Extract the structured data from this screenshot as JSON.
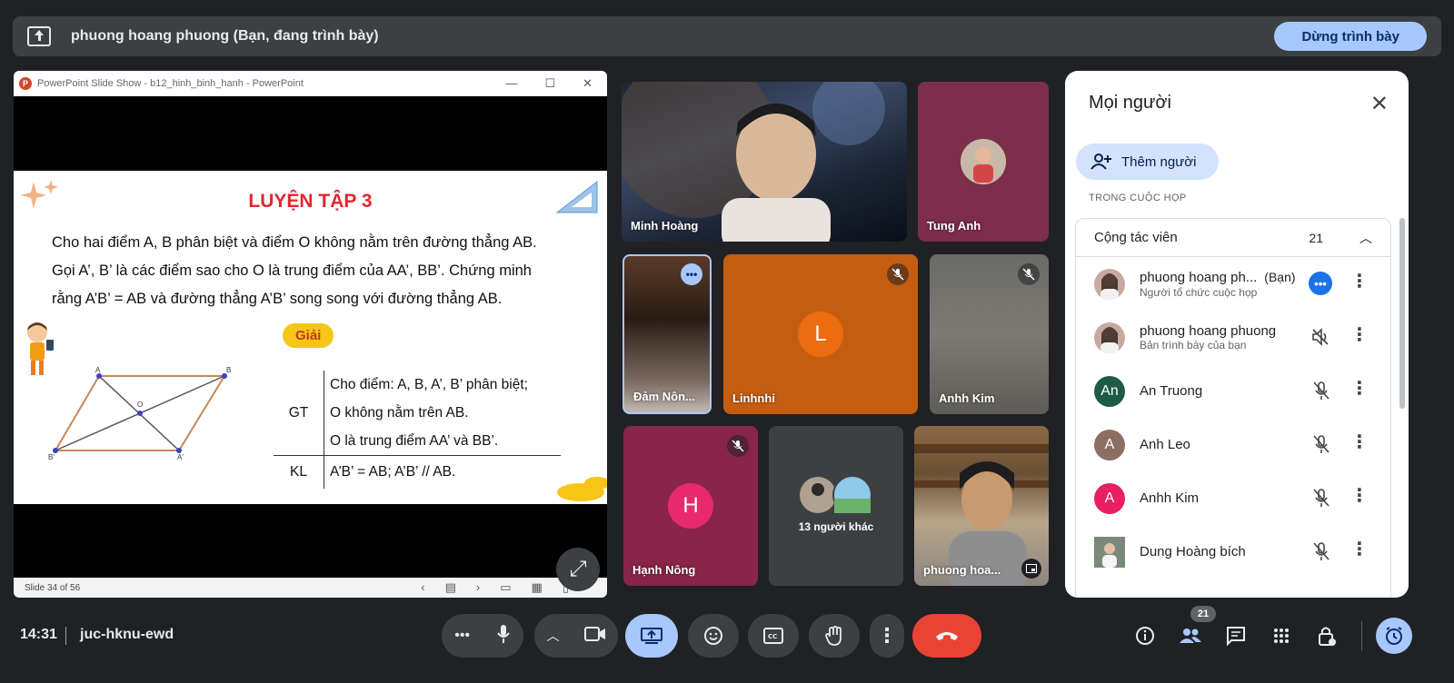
{
  "presenting_bar": {
    "text": "phuong hoang phuong (Bạn, đang trình bày)",
    "stop_label": "Dừng trình bày"
  },
  "ppt": {
    "window_title": "PowerPoint Slide Show  -  b12_hinh_binh_hanh - PowerPoint",
    "logo_letter": "P",
    "slide_title": "LUYỆN TẬP 3",
    "para_lines": [
      "Cho hai điểm A, B phân biệt và điểm O không nằm trên đường thẳng AB.",
      "Gọi A’, B’ là các điểm sao cho O là trung điểm của AA’, BB’. Chứng minh",
      "rằng A’B’ = AB và đường thẳng A’B’ song song với đường thẳng AB."
    ],
    "giai_label": "Giải",
    "gt_label": "GT",
    "gt_lines": [
      "Cho điểm: A, B, A’, B’ phân biệt;",
      "O không nằm trên AB.",
      "O là trung điểm AA’ và BB’."
    ],
    "kl_label": "KL",
    "kl_line": "A’B’ = AB; A’B’ // AB.",
    "figure_labels": {
      "a": "A",
      "b": "B",
      "o": "O",
      "a2": "A'",
      "b2": "B'"
    },
    "status": "Slide 34 of 56"
  },
  "tiles": {
    "minh": "Minh Hoàng",
    "tung": "Tung Anh",
    "dam": "Đảm Nôn...",
    "linh": "Linhnhi",
    "linh_letter": "L",
    "anhkim": "Anhh Kim",
    "hanh": "Hạnh Nông",
    "hanh_letter": "H",
    "others": "13 người khác",
    "phuong": "phuong hoa..."
  },
  "people": {
    "title": "Mọi người",
    "add_label": "Thêm người",
    "section": "TRONG CUỘC HỌP",
    "group_name": "Cộng tác viên",
    "group_count": "21",
    "rows": [
      {
        "name": "phuong hoang ph...",
        "tag": "(Bạn)",
        "sub": "Người tổ chức cuộc họp",
        "letter": "",
        "color": "#c7a9a0"
      },
      {
        "name": "phuong hoang phuong",
        "tag": "",
        "sub": "Bản trình bày của bạn",
        "letter": "",
        "color": "#c7a9a0"
      },
      {
        "name": "An Truong",
        "tag": "",
        "sub": "",
        "letter": "An",
        "color": "#1e5b45"
      },
      {
        "name": "Anh Leo",
        "tag": "",
        "sub": "",
        "letter": "A",
        "color": "#8d6e63"
      },
      {
        "name": "Anhh Kim",
        "tag": "",
        "sub": "",
        "letter": "A",
        "color": "#e91e63"
      },
      {
        "name": "Dung Hoàng bích",
        "tag": "",
        "sub": "",
        "letter": "",
        "color": "#9e9e9e"
      }
    ]
  },
  "bottom": {
    "time": "14:31",
    "meeting_code": "juc-hknu-ewd",
    "participants_badge": "21"
  },
  "colors": {
    "accent_blue": "#a8c7fa",
    "end_call_red": "#ea4335",
    "tile_maroon": "#7c2e4a",
    "tile_orange": "#c45d10",
    "tile_hanh": "#882548"
  }
}
